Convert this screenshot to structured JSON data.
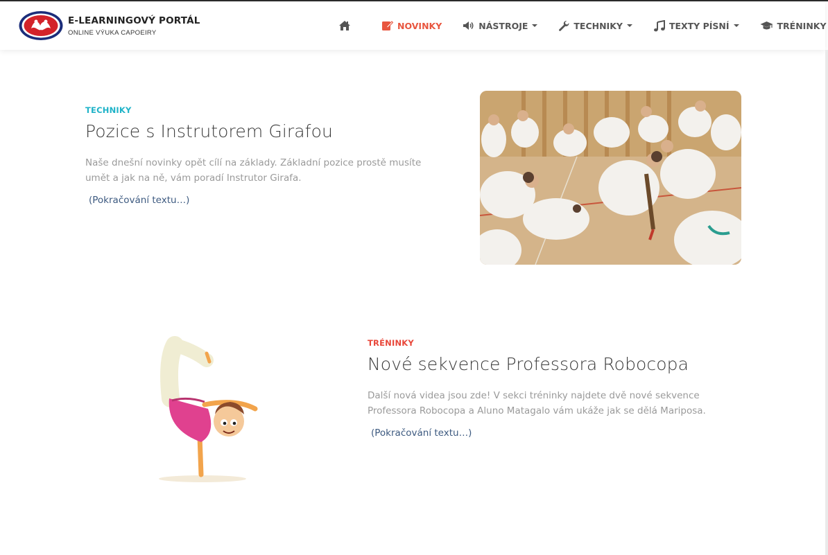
{
  "brand": {
    "title": "E-LEARNINGOVÝ PORTÁL",
    "subtitle": "ONLINE VÝUKA CAPOEIRY"
  },
  "nav": {
    "home_icon": "home-icon",
    "items": [
      {
        "label": "NOVINKY",
        "icon": "edit-icon",
        "active": true,
        "dropdown": false
      },
      {
        "label": "NÁSTROJE",
        "icon": "volume-icon",
        "active": false,
        "dropdown": true
      },
      {
        "label": "TECHNIKY",
        "icon": "wrench-icon",
        "active": false,
        "dropdown": true
      },
      {
        "label": "TEXTY PÍSNÍ",
        "icon": "music-icon",
        "active": false,
        "dropdown": true
      },
      {
        "label": "TRÉNINKY",
        "icon": "graduation-cap-icon",
        "active": false,
        "dropdown": false
      }
    ]
  },
  "colors": {
    "accent": "#e8563f",
    "techniky": "#1fb3c8",
    "treninky": "#e8473a",
    "link": "#3d5a80"
  },
  "articles": [
    {
      "category": "TECHNIKY",
      "title": "Pozice s Instrutorem Girafou",
      "excerpt_line1": "Naše dnešní novinky opět cílí na základy. Základní pozice prostě musíte",
      "excerpt_line2": "umět a jak na ně, vám poradí Instrutor Girafa.",
      "read_more": "(Pokračování textu…)"
    },
    {
      "category": "TRÉNINKY",
      "title": "Nové sekvence Professora Robocopa",
      "excerpt_line1": "Další nová videa jsou zde! V sekci tréninky najdete dvě nové sekvence",
      "excerpt_line2": "Professora Robocopa a Aluno Matagalo vám ukáže jak se dělá Mariposa.",
      "read_more": "(Pokračování textu…)"
    }
  ]
}
